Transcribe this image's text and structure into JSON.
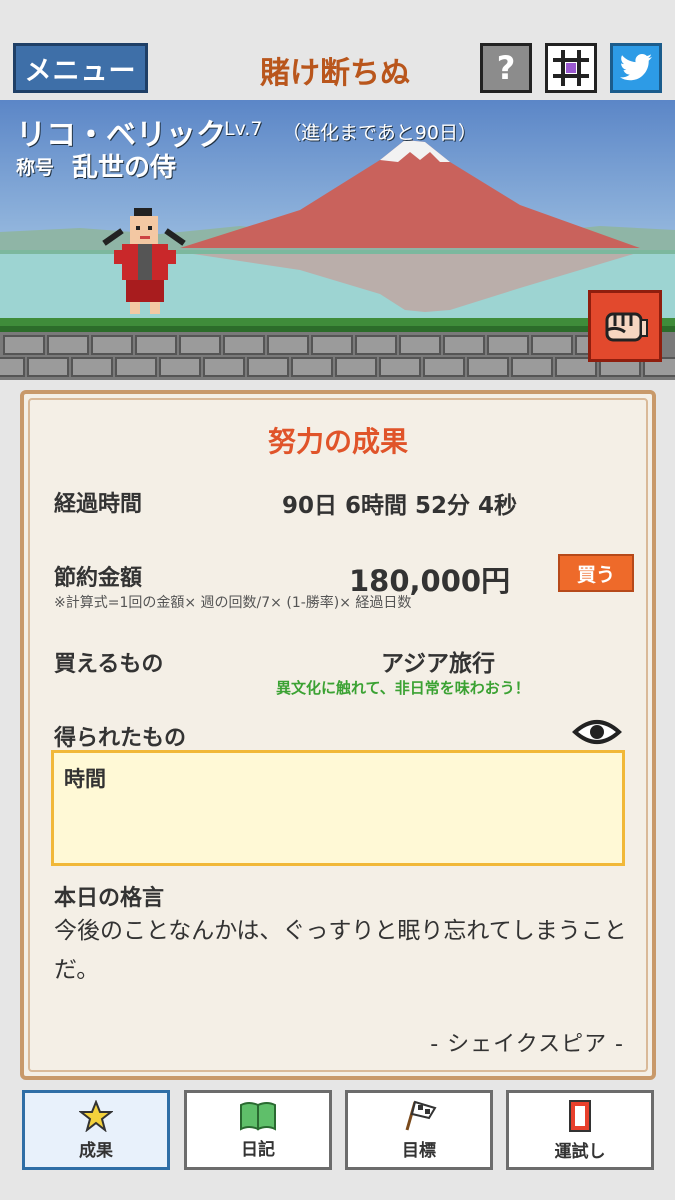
{
  "header": {
    "menu_label": "メニュー",
    "app_title": "賭け断ちぬ",
    "help_label": "?"
  },
  "character": {
    "name": "リコ・ベリック",
    "level": "Lv.7",
    "evolve_note": "（進化まであと90日）",
    "title_label": "称号",
    "title_value": "乱世の侍"
  },
  "results": {
    "heading": "努力の成果",
    "elapsed_label": "経過時間",
    "elapsed_value": "90日 6時間 52分 4秒",
    "saved_label": "節約金額",
    "saved_value": "180,000円",
    "formula": "※計算式=1回の金額× 週の回数/7× (1-勝率)× 経過日数",
    "buy_label": "買う",
    "buyable_label": "買えるもの",
    "buyable_value": "アジア旅行",
    "buyable_sub": "異文化に触れて、非日常を味わおう！",
    "gained_label": "得られたもの",
    "gained_value": "時間",
    "quote_label": "本日の格言",
    "quote_text": "今後のことなんかは、ぐっすりと眠り忘れてしまうことだ。",
    "quote_author": "- シェイクスピア -"
  },
  "nav": {
    "tabs": [
      {
        "label": "成果",
        "icon": "star-icon",
        "active": true
      },
      {
        "label": "日記",
        "icon": "book-icon",
        "active": false
      },
      {
        "label": "目標",
        "icon": "flag-icon",
        "active": false
      },
      {
        "label": "運試し",
        "icon": "card-icon",
        "active": false
      }
    ]
  },
  "colors": {
    "accent_orange": "#e0542a",
    "menu_blue": "#3e6fa8",
    "title_brown": "#b9561c",
    "panel_bg": "#f4efe6",
    "green_note": "#3ba233"
  }
}
